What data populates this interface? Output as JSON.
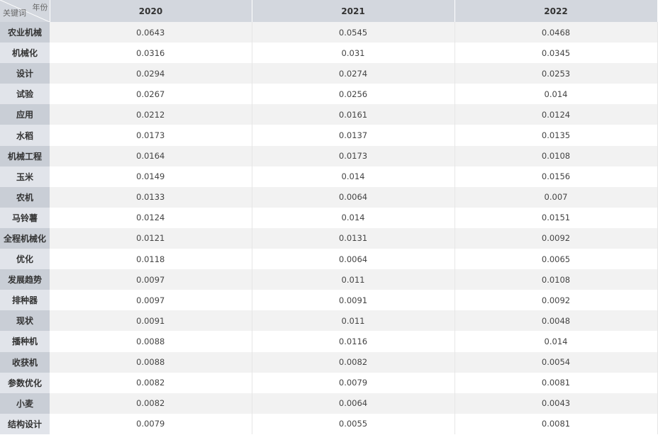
{
  "table": {
    "corner_top": "年份",
    "corner_bottom": "关键词",
    "years": [
      "2020",
      "2021",
      "2022"
    ],
    "rows": [
      {
        "keyword": "农业机械",
        "values": [
          "0.0643",
          "0.0545",
          "0.0468"
        ]
      },
      {
        "keyword": "机械化",
        "values": [
          "0.0316",
          "0.031",
          "0.0345"
        ]
      },
      {
        "keyword": "设计",
        "values": [
          "0.0294",
          "0.0274",
          "0.0253"
        ]
      },
      {
        "keyword": "试验",
        "values": [
          "0.0267",
          "0.0256",
          "0.014"
        ]
      },
      {
        "keyword": "应用",
        "values": [
          "0.0212",
          "0.0161",
          "0.0124"
        ]
      },
      {
        "keyword": "水稻",
        "values": [
          "0.0173",
          "0.0137",
          "0.0135"
        ]
      },
      {
        "keyword": "机械工程",
        "values": [
          "0.0164",
          "0.0173",
          "0.0108"
        ]
      },
      {
        "keyword": "玉米",
        "values": [
          "0.0149",
          "0.014",
          "0.0156"
        ]
      },
      {
        "keyword": "农机",
        "values": [
          "0.0133",
          "0.0064",
          "0.007"
        ]
      },
      {
        "keyword": "马铃薯",
        "values": [
          "0.0124",
          "0.014",
          "0.0151"
        ]
      },
      {
        "keyword": "全程机械化",
        "values": [
          "0.0121",
          "0.0131",
          "0.0092"
        ]
      },
      {
        "keyword": "优化",
        "values": [
          "0.0118",
          "0.0064",
          "0.0065"
        ]
      },
      {
        "keyword": "发展趋势",
        "values": [
          "0.0097",
          "0.011",
          "0.0108"
        ]
      },
      {
        "keyword": "排种器",
        "values": [
          "0.0097",
          "0.0091",
          "0.0092"
        ]
      },
      {
        "keyword": "现状",
        "values": [
          "0.0091",
          "0.011",
          "0.0048"
        ]
      },
      {
        "keyword": "播种机",
        "values": [
          "0.0088",
          "0.0116",
          "0.014"
        ]
      },
      {
        "keyword": "收获机",
        "values": [
          "0.0088",
          "0.0082",
          "0.0054"
        ]
      },
      {
        "keyword": "参数优化",
        "values": [
          "0.0082",
          "0.0079",
          "0.0081"
        ]
      },
      {
        "keyword": "小麦",
        "values": [
          "0.0082",
          "0.0064",
          "0.0043"
        ]
      },
      {
        "keyword": "结构设计",
        "values": [
          "0.0079",
          "0.0055",
          "0.0081"
        ]
      }
    ]
  }
}
